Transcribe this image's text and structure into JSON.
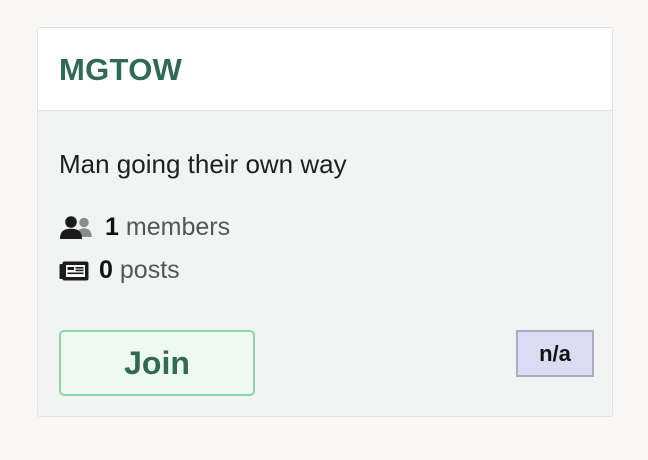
{
  "group": {
    "name": "MGTOW",
    "description": "Man going their own way",
    "members": {
      "count": "1",
      "label": "members",
      "icon": "users-icon"
    },
    "posts": {
      "count": "0",
      "label": "posts",
      "icon": "newspaper-icon"
    },
    "join_label": "Join",
    "badge": "n/a"
  },
  "colors": {
    "accent": "#2f6a53",
    "join_border": "#8ed4ab",
    "join_background": "#eef9f1",
    "badge_background": "#d9dcf2",
    "badge_border": "#a9acc6",
    "card_body": "#f2f4f3"
  }
}
